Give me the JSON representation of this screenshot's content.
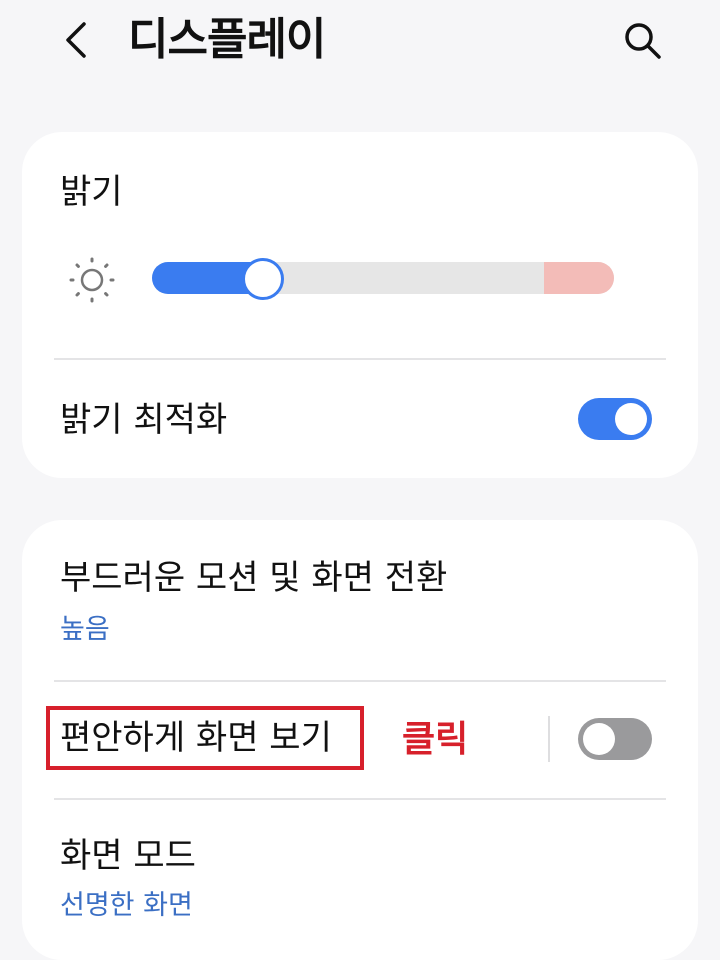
{
  "header": {
    "title": "디스플레이",
    "back_icon": "chevron-left-icon",
    "search_icon": "search-icon"
  },
  "brightness_card": {
    "brightness_label": "밝기",
    "brightness_icon": "sun-icon",
    "brightness_level": 0.24,
    "adaptive_label": "밝기 최적화",
    "adaptive_on": true
  },
  "display_card": {
    "motion_label": "부드러운 모션 및 화면 전환",
    "motion_value": "높음",
    "eye_comfort_label": "편안하게 화면 보기",
    "eye_comfort_on": false,
    "screen_mode_label": "화면 모드",
    "screen_mode_value": "선명한 화면"
  },
  "annotation": {
    "text": "클릭",
    "color": "#d7202b"
  },
  "colors": {
    "accent": "#3a7cf0",
    "subtext": "#3b6fc4",
    "toggle_off": "#9a9a9c",
    "background": "#f6f6f8"
  }
}
